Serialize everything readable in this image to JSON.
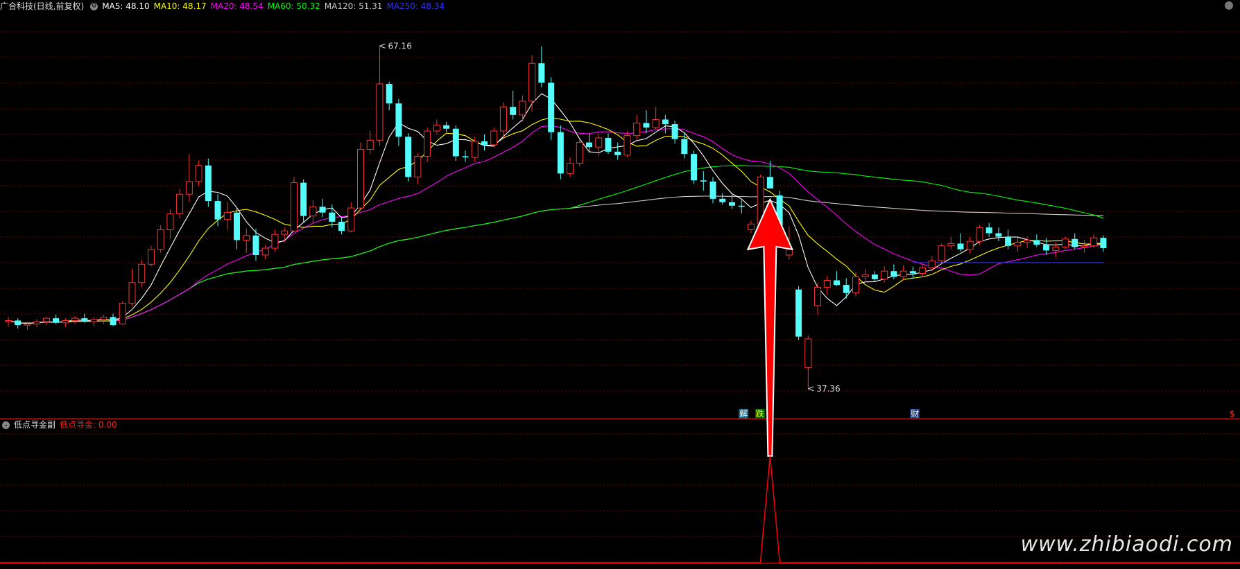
{
  "top_legend": {
    "title": "广合科技(日线,前复权)",
    "ma": [
      {
        "label": "MA5: 48.10",
        "color": "#ffffff"
      },
      {
        "label": "MA10: 48.17",
        "color": "#ffff00"
      },
      {
        "label": "MA20: 48.54",
        "color": "#ff00ff"
      },
      {
        "label": "MA60: 50.32",
        "color": "#00ff00"
      },
      {
        "label": "MA120: 51.31",
        "color": "#cccccc"
      },
      {
        "label": "MA250: 48.34",
        "color": "#3333ff"
      }
    ]
  },
  "sub_legend": {
    "title": "低点寻金副",
    "value_label": "低点寻金: 0.00",
    "value_color": "#ff2020"
  },
  "annotations": {
    "high": "67.16",
    "low": "37.36",
    "tags": [
      {
        "text": "解",
        "color": "#ffffff",
        "bg": "#1a5f7a"
      },
      {
        "text": "跌",
        "color": "#ffff00",
        "bg": "#006400"
      },
      {
        "text": "财",
        "color": "#ffffff",
        "bg": "#1a3a7a"
      },
      {
        "text": "$",
        "color": "#ff3030",
        "bg": "transparent"
      }
    ]
  },
  "watermark": "www.zhibiaodi.com",
  "colors": {
    "up": "#ff3232",
    "down": "#54fcfc",
    "grid": "#7a0000",
    "separator": "#cc0000",
    "arrow": "#ff0000"
  },
  "chart_data": {
    "type": "candlestick",
    "ylim": [
      35,
      70
    ],
    "candles": [
      [
        43.2,
        43.6,
        42.8,
        43.3
      ],
      [
        43.3,
        43.5,
        42.6,
        42.9
      ],
      [
        42.9,
        43.2,
        42.5,
        43.0
      ],
      [
        43.0,
        43.4,
        42.7,
        43.2
      ],
      [
        43.2,
        43.6,
        42.9,
        43.5
      ],
      [
        43.5,
        43.8,
        43.0,
        43.1
      ],
      [
        43.1,
        43.5,
        42.7,
        43.3
      ],
      [
        43.3,
        43.7,
        43.0,
        43.5
      ],
      [
        43.5,
        43.9,
        43.1,
        43.2
      ],
      [
        43.2,
        43.6,
        42.8,
        43.4
      ],
      [
        43.4,
        43.8,
        43.0,
        43.6
      ],
      [
        43.6,
        43.9,
        42.8,
        42.9
      ],
      [
        43.0,
        45.0,
        42.9,
        44.8
      ],
      [
        44.8,
        47.8,
        44.6,
        46.6
      ],
      [
        46.6,
        48.6,
        46.2,
        48.2
      ],
      [
        48.2,
        49.8,
        48.0,
        49.5
      ],
      [
        49.5,
        51.6,
        49.2,
        51.2
      ],
      [
        51.2,
        53.0,
        50.4,
        52.6
      ],
      [
        52.6,
        54.8,
        52.2,
        54.3
      ],
      [
        54.3,
        57.8,
        53.6,
        55.4
      ],
      [
        55.4,
        57.2,
        55.0,
        56.8
      ],
      [
        56.8,
        57.4,
        53.2,
        53.7
      ],
      [
        53.7,
        54.3,
        51.5,
        52.1
      ],
      [
        52.1,
        53.6,
        51.2,
        52.7
      ],
      [
        52.7,
        53.2,
        49.5,
        50.3
      ],
      [
        50.3,
        51.3,
        49.2,
        50.7
      ],
      [
        50.7,
        51.3,
        48.5,
        49.0
      ],
      [
        49.0,
        49.9,
        48.6,
        49.6
      ],
      [
        49.6,
        51.2,
        49.3,
        50.8
      ],
      [
        50.8,
        51.4,
        50.1,
        51.1
      ],
      [
        51.1,
        55.8,
        51.0,
        55.3
      ],
      [
        55.3,
        55.6,
        51.8,
        52.4
      ],
      [
        52.4,
        53.8,
        51.8,
        53.2
      ],
      [
        53.2,
        53.9,
        52.3,
        52.7
      ],
      [
        52.7,
        53.4,
        51.4,
        51.9
      ],
      [
        51.9,
        52.3,
        50.8,
        51.1
      ],
      [
        51.1,
        53.6,
        51.0,
        53.1
      ],
      [
        53.1,
        58.8,
        53.0,
        58.2
      ],
      [
        58.2,
        59.8,
        57.8,
        59.0
      ],
      [
        59.0,
        67.2,
        58.5,
        63.9
      ],
      [
        63.9,
        64.1,
        61.6,
        62.2
      ],
      [
        62.2,
        62.6,
        58.5,
        59.3
      ],
      [
        59.3,
        59.6,
        55.4,
        55.8
      ],
      [
        55.8,
        57.9,
        55.2,
        57.6
      ],
      [
        57.6,
        60.1,
        57.1,
        59.8
      ],
      [
        59.8,
        60.8,
        59.5,
        60.3
      ],
      [
        60.3,
        60.6,
        59.7,
        60.0
      ],
      [
        60.0,
        60.3,
        57.2,
        57.6
      ],
      [
        57.6,
        58.1,
        57.1,
        57.5
      ],
      [
        57.5,
        59.3,
        57.1,
        58.9
      ],
      [
        58.9,
        59.5,
        58.1,
        58.6
      ],
      [
        58.6,
        60.1,
        58.4,
        59.8
      ],
      [
        59.8,
        62.3,
        59.2,
        61.9
      ],
      [
        61.9,
        63.3,
        60.8,
        61.2
      ],
      [
        61.2,
        62.9,
        60.6,
        62.4
      ],
      [
        62.4,
        66.4,
        61.5,
        65.7
      ],
      [
        65.7,
        67.16,
        63.6,
        64.0
      ],
      [
        64.0,
        64.5,
        59.0,
        59.7
      ],
      [
        59.7,
        60.3,
        55.6,
        56.1
      ],
      [
        56.1,
        57.5,
        55.8,
        57.0
      ],
      [
        57.0,
        59.1,
        56.7,
        58.8
      ],
      [
        58.8,
        59.6,
        57.9,
        58.4
      ],
      [
        58.4,
        59.6,
        57.6,
        59.2
      ],
      [
        59.2,
        59.6,
        57.8,
        58.0
      ],
      [
        58.0,
        58.8,
        57.3,
        57.7
      ],
      [
        57.7,
        59.8,
        57.5,
        59.4
      ],
      [
        59.4,
        61.2,
        59.0,
        60.5
      ],
      [
        60.5,
        61.6,
        59.6,
        60.1
      ],
      [
        60.1,
        61.9,
        59.9,
        60.8
      ],
      [
        60.8,
        61.2,
        59.6,
        60.4
      ],
      [
        60.4,
        60.7,
        58.7,
        59.1
      ],
      [
        59.1,
        59.6,
        57.4,
        57.8
      ],
      [
        57.8,
        58.1,
        55.2,
        55.5
      ],
      [
        55.5,
        56.3,
        54.6,
        55.4
      ],
      [
        55.4,
        55.8,
        53.5,
        53.9
      ],
      [
        53.9,
        54.4,
        53.4,
        53.6
      ],
      [
        53.6,
        54.3,
        53.0,
        53.3
      ],
      [
        53.3,
        53.8,
        52.6,
        53.2
      ],
      [
        51.2,
        52.0,
        50.9,
        51.7
      ],
      [
        51.7,
        56.0,
        51.5,
        55.8
      ],
      [
        55.8,
        57.2,
        54.8,
        54.8
      ],
      [
        54.2,
        54.6,
        51.1,
        51.6
      ],
      [
        49.0,
        51.5,
        48.6,
        49.5
      ],
      [
        46.0,
        46.3,
        41.6,
        41.9
      ],
      [
        39.2,
        42.0,
        37.36,
        41.7
      ],
      [
        44.6,
        46.6,
        43.8,
        46.2
      ],
      [
        46.2,
        47.2,
        45.5,
        46.8
      ],
      [
        46.8,
        47.6,
        46.3,
        46.4
      ],
      [
        46.4,
        47.0,
        45.2,
        45.7
      ],
      [
        45.7,
        47.5,
        45.4,
        47.1
      ],
      [
        47.1,
        47.8,
        46.6,
        47.3
      ],
      [
        47.3,
        47.6,
        46.7,
        46.9
      ],
      [
        46.9,
        48.0,
        46.6,
        47.6
      ],
      [
        47.6,
        48.2,
        46.9,
        47.1
      ],
      [
        47.1,
        48.1,
        46.8,
        47.6
      ],
      [
        47.6,
        48.0,
        47.0,
        47.4
      ],
      [
        47.4,
        48.2,
        47.1,
        47.9
      ],
      [
        47.9,
        48.9,
        47.6,
        48.5
      ],
      [
        48.5,
        50.0,
        48.2,
        49.8
      ],
      [
        49.8,
        50.6,
        49.5,
        50.0
      ],
      [
        50.0,
        50.9,
        49.3,
        49.5
      ],
      [
        49.5,
        50.6,
        49.1,
        50.2
      ],
      [
        50.2,
        51.6,
        49.9,
        51.4
      ],
      [
        51.4,
        51.8,
        50.6,
        50.9
      ],
      [
        50.9,
        51.4,
        50.2,
        50.6
      ],
      [
        50.6,
        51.2,
        49.5,
        49.8
      ],
      [
        49.8,
        50.5,
        49.3,
        50.1
      ],
      [
        50.1,
        50.6,
        49.6,
        50.3
      ],
      [
        50.3,
        50.8,
        49.7,
        49.9
      ],
      [
        49.9,
        50.5,
        49.0,
        49.4
      ],
      [
        49.4,
        50.1,
        48.8,
        49.7
      ],
      [
        49.7,
        50.6,
        49.5,
        50.4
      ],
      [
        50.4,
        50.9,
        49.5,
        49.7
      ],
      [
        49.7,
        50.3,
        49.2,
        49.8
      ],
      [
        49.8,
        50.8,
        49.6,
        50.5
      ],
      [
        50.5,
        50.7,
        49.3,
        49.6
      ]
    ],
    "ma250_segment": {
      "from_index": 95,
      "value": 48.34
    },
    "signal": {
      "label": "低点寻金",
      "index": 80,
      "peak": 1.0,
      "value_now": 0.0
    }
  }
}
